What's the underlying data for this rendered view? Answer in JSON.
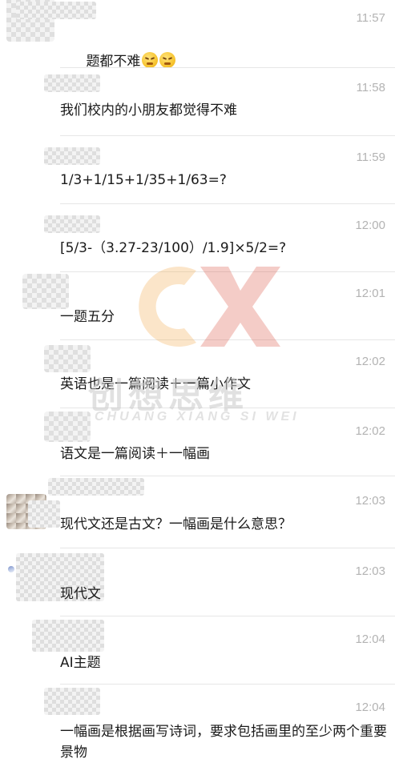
{
  "messages": [
    {
      "time": "11:57",
      "text": "题都不难",
      "emoji": [
        "persevering-face-emoji",
        "persevering-face-emoji"
      ]
    },
    {
      "time": "11:58",
      "text": "我们校内的小朋友都觉得不难"
    },
    {
      "time": "11:59",
      "text": "1/3+1/15+1/35+1/63=?"
    },
    {
      "time": "12:00",
      "text": "[5/3-（3.27-23/100）/1.9]×5/2=?"
    },
    {
      "time": "12:01",
      "text": "一题五分"
    },
    {
      "time": "12:02",
      "text": "英语也是一篇阅读＋一篇小作文"
    },
    {
      "time": "12:02",
      "text": "语文是一篇阅读＋一幅画"
    },
    {
      "time": "12:03",
      "text": "现代文还是古文？一幅画是什么意思？"
    },
    {
      "time": "12:03",
      "text": "现代文"
    },
    {
      "time": "12:04",
      "text": "AI主题"
    },
    {
      "time": "12:04",
      "text": "一幅画是根据画写诗词，要求包括画里的至少两个重要景物"
    }
  ],
  "watermark": {
    "logo_text": "CX",
    "cn_text": "创想思维",
    "en_text": "CHUANG XIANG SI WEI",
    "colors": {
      "c": "#f4a640",
      "x": "#d94a3a"
    }
  }
}
